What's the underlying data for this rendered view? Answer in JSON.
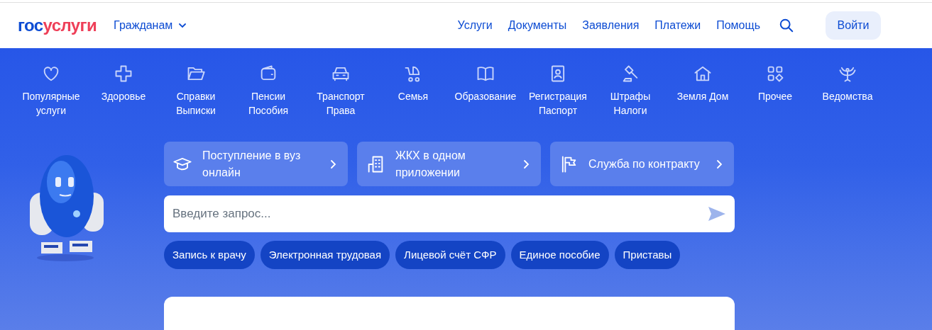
{
  "header": {
    "logo": {
      "first": "гос",
      "second": "услуги"
    },
    "audience_menu": "Гражданам",
    "nav": [
      "Услуги",
      "Документы",
      "Заявления",
      "Платежи",
      "Помощь"
    ],
    "login_button": "Войти"
  },
  "categories": [
    {
      "kind": "heart",
      "lines": [
        "Популярные",
        "услуги"
      ]
    },
    {
      "kind": "cross",
      "lines": [
        "Здоровье"
      ]
    },
    {
      "kind": "folder",
      "lines": [
        "Справки",
        "Выписки"
      ]
    },
    {
      "kind": "wallet",
      "lines": [
        "Пенсии",
        "Пособия"
      ]
    },
    {
      "kind": "car",
      "lines": [
        "Транспорт",
        "Права"
      ]
    },
    {
      "kind": "stroller",
      "lines": [
        "Семья"
      ]
    },
    {
      "kind": "book",
      "lines": [
        "Образование"
      ]
    },
    {
      "kind": "badge",
      "lines": [
        "Регистрация",
        "Паспорт"
      ]
    },
    {
      "kind": "gavel",
      "lines": [
        "Штрафы",
        "Налоги"
      ]
    },
    {
      "kind": "house",
      "lines": [
        "Земля Дом"
      ]
    },
    {
      "kind": "grid",
      "lines": [
        "Прочее"
      ]
    },
    {
      "kind": "eagle",
      "lines": [
        "Ведомства"
      ]
    }
  ],
  "promo_cards": [
    {
      "kind": "cap",
      "text": "Поступление в вуз онлайн"
    },
    {
      "kind": "building",
      "text": "ЖКХ в одном приложении"
    },
    {
      "kind": "flag",
      "text": "Служба по контракту"
    }
  ],
  "search": {
    "placeholder": "Введите запрос..."
  },
  "quick_links": [
    "Запись к врачу",
    "Электронная трудовая",
    "Лицевой счёт СФР",
    "Единое пособие",
    "Приставы"
  ]
}
